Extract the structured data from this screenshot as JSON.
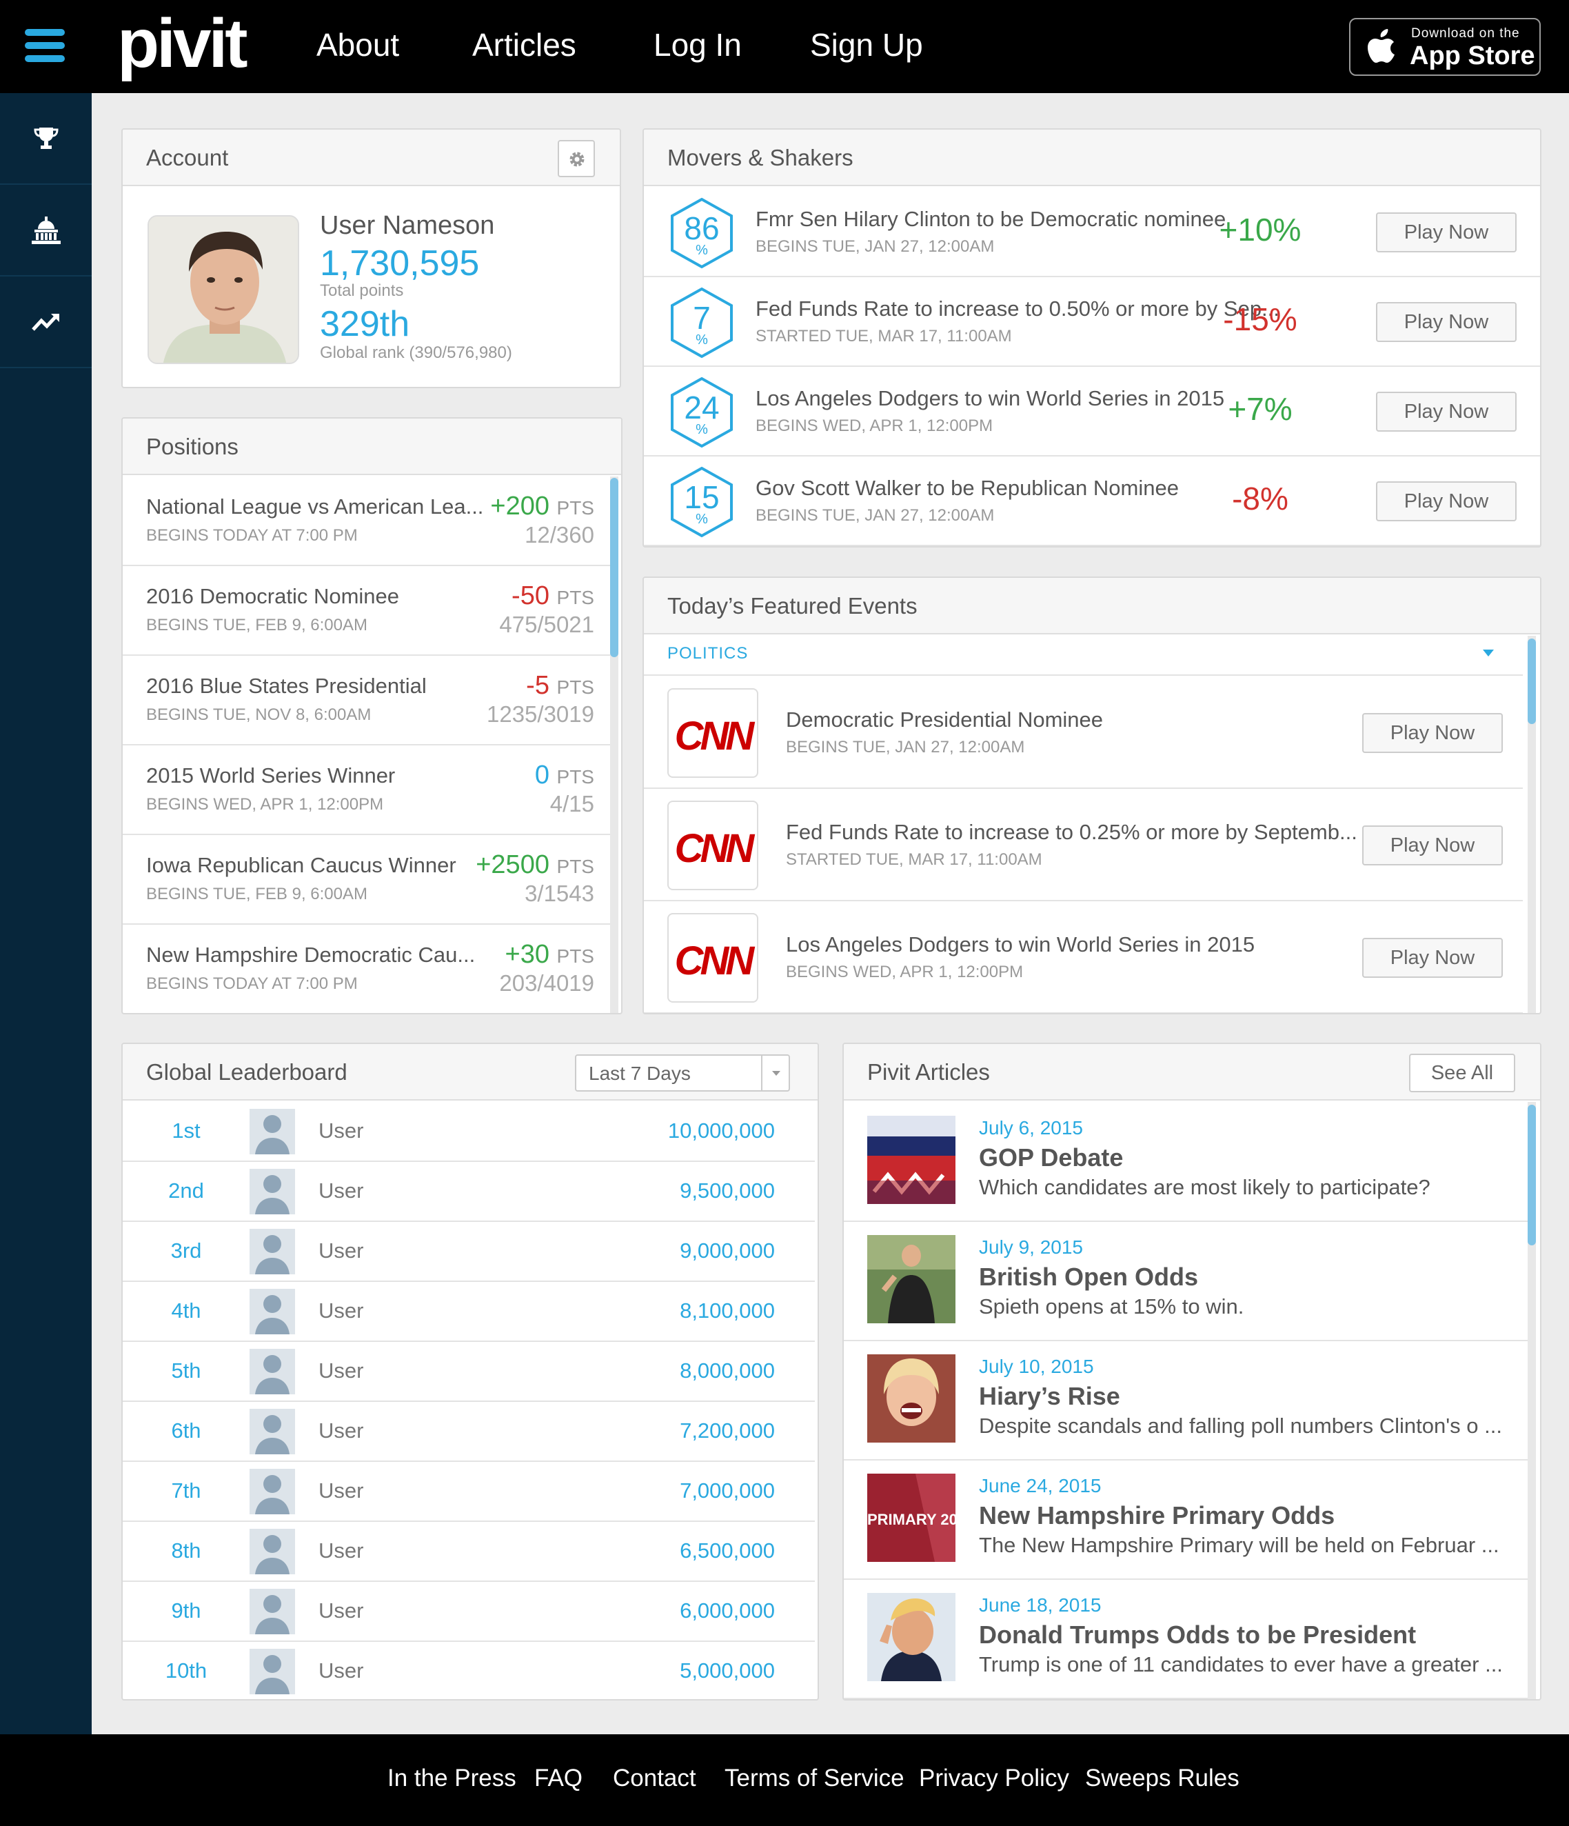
{
  "nav": {
    "logo": "pivit",
    "links": [
      "About",
      "Articles",
      "Log In",
      "Sign Up"
    ],
    "app_store_small": "Download on the",
    "app_store_big": "App Store"
  },
  "sidebar": {
    "icons": [
      "trophy-icon",
      "capitol-icon",
      "trending-icon"
    ]
  },
  "account": {
    "title": "Account",
    "name": "User Nameson",
    "points": "1,730,595",
    "points_label": "Total points",
    "rank": "329th",
    "rank_label": "Global rank (390/576,980)"
  },
  "positions": {
    "title": "Positions",
    "unit": "PTS",
    "rows": [
      {
        "title": "National League vs American Lea...",
        "sub": "BEGINS TODAY AT 7:00 PM",
        "pts": "+200",
        "frac": "12/360",
        "color": "green"
      },
      {
        "title": "2016 Democratic Nominee",
        "sub": "BEGINS TUE, FEB 9, 6:00AM",
        "pts": "-50",
        "frac": "475/5021",
        "color": "red"
      },
      {
        "title": "2016 Blue States Presidential",
        "sub": "BEGINS TUE, NOV 8, 6:00AM",
        "pts": "-5",
        "frac": "1235/3019",
        "color": "red"
      },
      {
        "title": "2015 World Series Winner",
        "sub": "BEGINS WED, APR 1, 12:00PM",
        "pts": "0",
        "frac": "4/15",
        "color": "blue"
      },
      {
        "title": "Iowa Republican Caucus Winner",
        "sub": "BEGINS TUE, FEB 9, 6:00AM",
        "pts": "+2500",
        "frac": "3/1543",
        "color": "green"
      },
      {
        "title": "New Hampshire Democratic Cau...",
        "sub": "BEGINS TODAY AT 7:00 PM",
        "pts": "+30",
        "frac": "203/4019",
        "color": "green"
      }
    ]
  },
  "movers": {
    "title": "Movers & Shakers",
    "play_label": "Play Now",
    "pct_sign": "%",
    "rows": [
      {
        "num": "86",
        "title": "Fmr Sen Hilary Clinton to be Democratic nominee",
        "sub": "BEGINS TUE, JAN 27, 12:00AM",
        "change": "+10%",
        "color": "green"
      },
      {
        "num": "7",
        "title": "Fed Funds Rate to increase to 0.50% or more by Sep...",
        "sub": "STARTED TUE, MAR 17, 11:00AM",
        "change": "-15%",
        "color": "red"
      },
      {
        "num": "24",
        "title": "Los Angeles Dodgers to win World Series in 2015",
        "sub": "BEGINS WED, APR 1, 12:00PM",
        "change": "+7%",
        "color": "green"
      },
      {
        "num": "15",
        "title": "Gov Scott Walker to be Republican Nominee",
        "sub": "BEGINS TUE, JAN 27, 12:00AM",
        "change": "-8%",
        "color": "red"
      }
    ]
  },
  "featured": {
    "title": "Today’s Featured Events",
    "filter": "POLITICS",
    "play_label": "Play Now",
    "logo_text": "CNN",
    "rows": [
      {
        "title": "Democratic Presidential Nominee",
        "sub": "BEGINS TUE, JAN 27, 12:00AM"
      },
      {
        "title": "Fed Funds Rate to increase to 0.25% or more by Septemb...",
        "sub": "STARTED TUE, MAR 17, 11:00AM"
      },
      {
        "title": "Los Angeles Dodgers to win World Series in 2015",
        "sub": "BEGINS WED, APR 1, 12:00PM"
      }
    ]
  },
  "leaderboard": {
    "title": "Global Leaderboard",
    "period": "Last 7 Days",
    "rows": [
      {
        "rank": "1st",
        "user": "User",
        "score": "10,000,000"
      },
      {
        "rank": "2nd",
        "user": "User",
        "score": "9,500,000"
      },
      {
        "rank": "3rd",
        "user": "User",
        "score": "9,000,000"
      },
      {
        "rank": "4th",
        "user": "User",
        "score": "8,100,000"
      },
      {
        "rank": "5th",
        "user": "User",
        "score": "8,000,000"
      },
      {
        "rank": "6th",
        "user": "User",
        "score": "7,200,000"
      },
      {
        "rank": "7th",
        "user": "User",
        "score": "7,000,000"
      },
      {
        "rank": "8th",
        "user": "User",
        "score": "6,500,000"
      },
      {
        "rank": "9th",
        "user": "User",
        "score": "6,000,000"
      },
      {
        "rank": "10th",
        "user": "User",
        "score": "5,000,000"
      }
    ]
  },
  "articles": {
    "title": "Pivit Articles",
    "see_all": "See All",
    "rows": [
      {
        "date": "July 6, 2015",
        "title": "GOP Debate",
        "desc": "Which candidates are most likely to participate?",
        "thumb_text": ""
      },
      {
        "date": "July 9, 2015",
        "title": "British Open Odds",
        "desc": "Spieth opens at 15% to win.",
        "thumb_text": ""
      },
      {
        "date": "July 10, 2015",
        "title": "Hiary’s Rise",
        "desc": "Despite scandals and falling poll numbers Clinton's o ...",
        "thumb_text": ""
      },
      {
        "date": "June 24, 2015",
        "title": "New Hampshire Primary Odds",
        "desc": "The New Hampshire Primary will be held on Februar ...",
        "thumb_text": "PRIMARY 20"
      },
      {
        "date": "June 18, 2015",
        "title": "Donald Trumps Odds to be President",
        "desc": "Trump is one of 11 candidates to ever have a greater ...",
        "thumb_text": ""
      }
    ]
  },
  "footer": {
    "links": [
      "In the Press",
      "FAQ",
      "Contact",
      "Terms of Service",
      "Privacy Policy",
      "Sweeps Rules"
    ]
  },
  "colors": {
    "accent": "#2aa9e0",
    "positive": "#3aa84a",
    "negative": "#d2322d",
    "sidebar": "#07263b"
  }
}
